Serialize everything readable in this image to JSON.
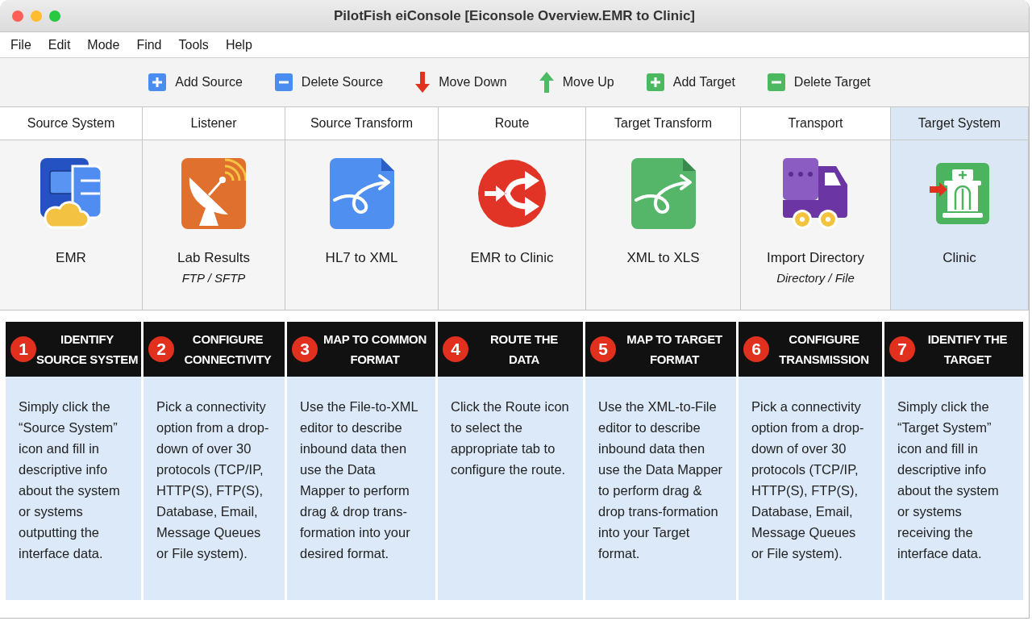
{
  "window": {
    "title": "PilotFish eiConsole [Eiconsole Overview.EMR to Clinic]"
  },
  "menu": [
    "File",
    "Edit",
    "Mode",
    "Find",
    "Tools",
    "Help"
  ],
  "toolbar": [
    "Add Source",
    "Delete Source",
    "Move Down",
    "Move Up",
    "Add Target",
    "Delete Target"
  ],
  "columns": [
    {
      "header": "Source System",
      "label": "EMR",
      "selected": false
    },
    {
      "header": "Listener",
      "label": "Lab Results",
      "subtitle": "FTP / SFTP",
      "selected": false
    },
    {
      "header": "Source Transform",
      "label": "HL7 to XML",
      "selected": false
    },
    {
      "header": "Route",
      "label": "EMR to Clinic",
      "selected": false
    },
    {
      "header": "Target Transform",
      "label": "XML to XLS",
      "selected": false
    },
    {
      "header": "Transport",
      "label": "Import Directory",
      "subtitle": "Directory / File",
      "selected": false
    },
    {
      "header": "Target System",
      "label": "Clinic",
      "selected": true
    }
  ],
  "steps": [
    {
      "number": "1",
      "title": [
        "IDENTIFY",
        "SOURCE SYSTEM"
      ],
      "description": "Simply click the “Source System” icon and fill in descriptive info about the system or systems outputting the interface data."
    },
    {
      "number": "2",
      "title": [
        "CONFIGURE",
        "CONNECTIVITY"
      ],
      "description": "Pick a connectivity option from a drop-down of over 30 protocols (TCP/IP, HTTP(S), FTP(S), Database, Email, Message Queues or File system)."
    },
    {
      "number": "3",
      "title": [
        "MAP TO COMMON",
        "FORMAT"
      ],
      "description": "Use the File-to-XML editor to describe inbound data then use the Data Mapper to perform drag & drop trans-formation into your desired format."
    },
    {
      "number": "4",
      "title": [
        "ROUTE THE",
        "DATA"
      ],
      "description": "Click the Route icon to select the appropriate tab to configure the route."
    },
    {
      "number": "5",
      "title": [
        "MAP TO TARGET",
        "FORMAT"
      ],
      "description": "Use the XML-to-File editor to describe inbound data then use the Data Mapper to perform drag & drop trans-formation into your Target format."
    },
    {
      "number": "6",
      "title": [
        "CONFIGURE",
        "TRANSMISSION"
      ],
      "description": "Pick a connectivity option from a drop-down of over 30 protocols (TCP/IP, HTTP(S), FTP(S), Database, Email, Message Queues or File system)."
    },
    {
      "number": "7",
      "title": [
        "IDENTIFY THE",
        "TARGET"
      ],
      "description": "Simply click the “Target System” icon and fill in descriptive info about the system or systems receiving the interface data."
    }
  ]
}
